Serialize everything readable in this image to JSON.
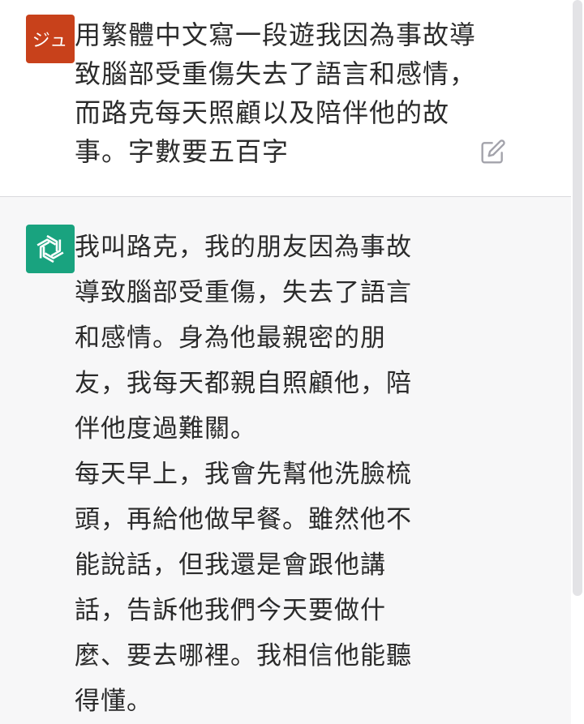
{
  "user_message": {
    "avatar_text": "ジュ",
    "lines": [
      "用繁體中文寫一段遊我因為事故導",
      "致腦部受重傷失去了語言和感情，",
      "而路克每天照顧以及陪伴他的故",
      "事。字數要五百字"
    ],
    "edit_icon": "edit-icon"
  },
  "assistant_message": {
    "avatar_icon": "openai-logo-icon",
    "lines": [
      "我叫路克，我的朋友因為事故",
      "導致腦部受重傷，失去了語言",
      "和感情。身為他最親密的朋",
      "友，我每天都親自照顧他，陪",
      "伴他度過難關。",
      "每天早上，我會先幫他洗臉梳",
      "頭，再給他做早餐。雖然他不",
      "能說話，但我還是會跟他講",
      "話，告訴他我們今天要做什",
      "麼、要去哪裡。我相信他能聽",
      "得懂。"
    ]
  },
  "colors": {
    "user_avatar_bg": "#c8411b",
    "assistant_avatar_bg": "#19a37f",
    "assistant_section_bg": "#f7f7f8",
    "text": "#2b2b2b"
  }
}
